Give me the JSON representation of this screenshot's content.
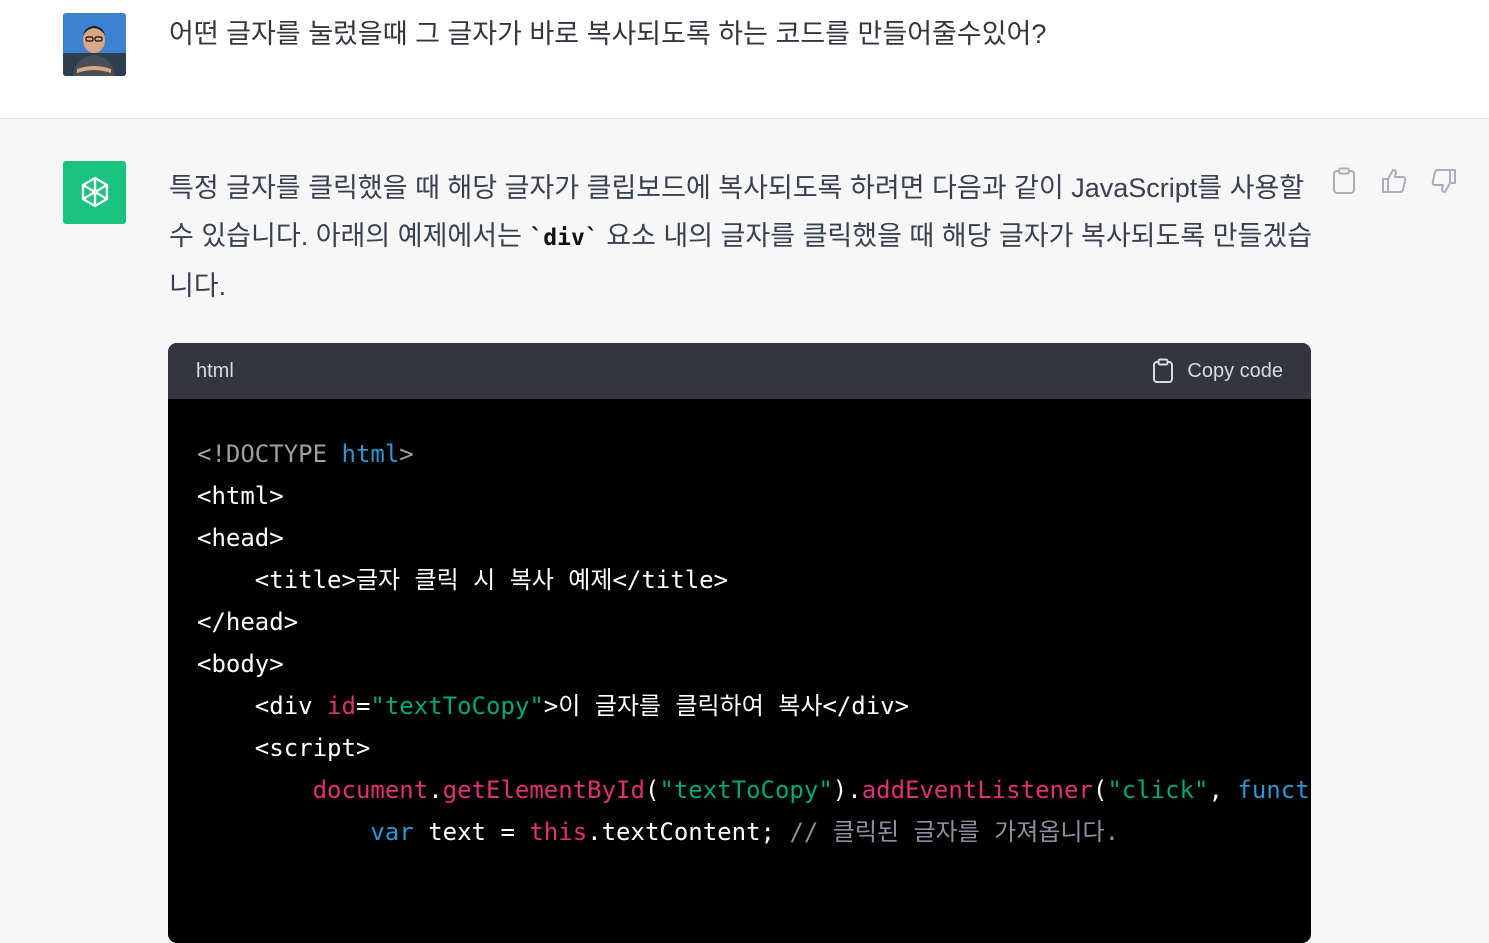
{
  "user": {
    "message": "어떤 글자를 눌렀을때 그 글자가 바로 복사되도록 하는 코드를 만들어줄수있어?"
  },
  "assistant": {
    "intro_part1": "특정 글자를 클릭했을 때 해당 글자가 클립보드에 복사되도록 하려면 다음과 같이 JavaScript를 사용할 수 있습니다. 아래의 예제에서는 ",
    "inline_code": "`div`",
    "intro_part2": " 요소 내의 글자를 클릭했을 때 해당 글자가 복사되도록 만들겠습니다."
  },
  "code_block": {
    "language": "html",
    "copy_label": "Copy code",
    "lines": {
      "l1_a": "<!DOCTYPE ",
      "l1_b": "html",
      "l1_c": ">",
      "l2": "<html>",
      "l3": "<head>",
      "l4": "    <title>글자 클릭 시 복사 예제</title>",
      "l5": "</head>",
      "l6": "<body>",
      "l7_a": "    <div ",
      "l7_b": "id",
      "l7_c": "=",
      "l7_d": "\"textToCopy\"",
      "l7_e": ">이 글자를 클릭하여 복사</div>",
      "l8": "",
      "l9": "    <script>",
      "l10_a": "        ",
      "l10_b": "document",
      "l10_c": ".",
      "l10_d": "getElementById",
      "l10_e": "(",
      "l10_f": "\"textToCopy\"",
      "l10_g": ").",
      "l10_h": "addEventListener",
      "l10_i": "(",
      "l10_j": "\"click\"",
      "l10_k": ", ",
      "l10_l": "function",
      "l11_a": "            ",
      "l11_b": "var",
      "l11_c": " text = ",
      "l11_d": "this",
      "l11_e": ".textContent; ",
      "l11_f": "// 클릭된 글자를 가져옵니다."
    }
  },
  "icons": {
    "copy": "clipboard-icon",
    "like": "thumbs-up-icon",
    "dislike": "thumbs-down-icon",
    "assistant_logo": "openai-logo-icon"
  },
  "colors": {
    "accent_green": "#19c37d",
    "code_header": "#343541",
    "code_bg": "#000000"
  }
}
